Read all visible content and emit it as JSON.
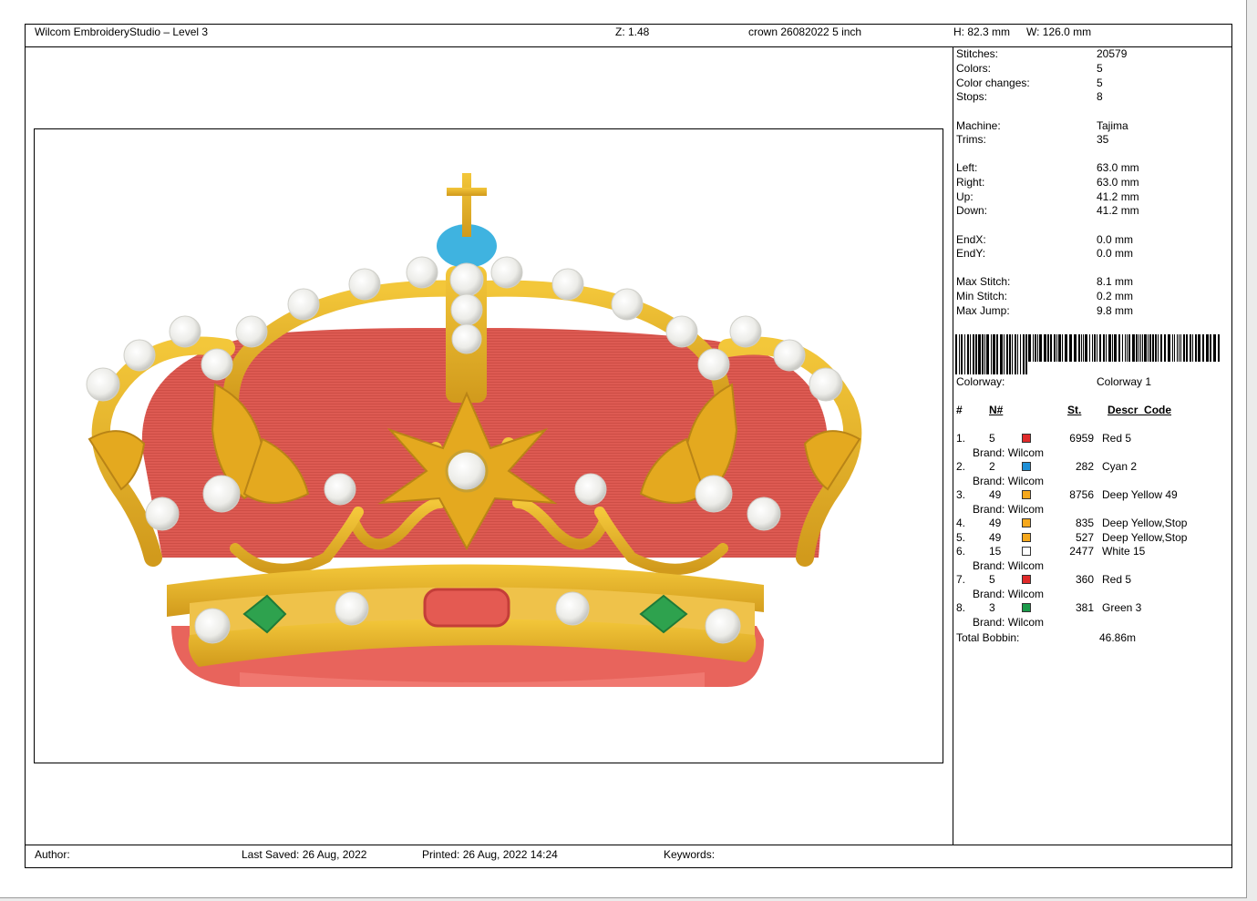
{
  "header": {
    "app_title": "Wilcom EmbroideryStudio – Level 3",
    "zoom": "Z: 1.48",
    "design_name": "crown 26082022 5 inch",
    "height": "H: 82.3 mm",
    "width": "W: 126.0 mm"
  },
  "stats": [
    {
      "label": "Stitches:",
      "value": "20579"
    },
    {
      "label": "Colors:",
      "value": "5"
    },
    {
      "label": "Color changes:",
      "value": "5"
    },
    {
      "label": "Stops:",
      "value": "8"
    },
    {
      "label": "Machine:",
      "value": "Tajima"
    },
    {
      "label": "Trims:",
      "value": "35"
    },
    {
      "label": "Left:",
      "value": "63.0 mm"
    },
    {
      "label": "Right:",
      "value": "63.0 mm"
    },
    {
      "label": "Up:",
      "value": "41.2 mm"
    },
    {
      "label": "Down:",
      "value": "41.2 mm"
    },
    {
      "label": "EndX:",
      "value": "0.0 mm"
    },
    {
      "label": "EndY:",
      "value": "0.0 mm"
    },
    {
      "label": "Max Stitch:",
      "value": "8.1 mm"
    },
    {
      "label": "Min Stitch:",
      "value": "0.2 mm"
    },
    {
      "label": "Max Jump:",
      "value": "9.8 mm"
    }
  ],
  "colorway": {
    "label": "Colorway:",
    "value": "Colorway 1"
  },
  "table": {
    "headers": {
      "index": "#",
      "needle": "N#",
      "stitches": "St.",
      "descr": "Descr_Code"
    },
    "rows": [
      {
        "index": "1.",
        "needle": "5",
        "color": "#e02a2a",
        "stitches": "6959",
        "descr": "Red 5",
        "brand": "Brand: Wilcom"
      },
      {
        "index": "2.",
        "needle": "2",
        "color": "#1e8fd6",
        "stitches": "282",
        "descr": "Cyan 2",
        "brand": "Brand: Wilcom"
      },
      {
        "index": "3.",
        "needle": "49",
        "color": "#f5a81c",
        "stitches": "8756",
        "descr": "Deep Yellow 49",
        "brand": "Brand: Wilcom"
      },
      {
        "index": "4.",
        "needle": "49",
        "color": "#f5a81c",
        "stitches": "835",
        "descr": "Deep Yellow,Stop",
        "brand": ""
      },
      {
        "index": "5.",
        "needle": "49",
        "color": "#f5a81c",
        "stitches": "527",
        "descr": "Deep Yellow,Stop",
        "brand": ""
      },
      {
        "index": "6.",
        "needle": "15",
        "color": "#ffffff",
        "stitches": "2477",
        "descr": "White 15",
        "brand": "Brand: Wilcom"
      },
      {
        "index": "7.",
        "needle": "5",
        "color": "#e02a2a",
        "stitches": "360",
        "descr": "Red 5",
        "brand": "Brand: Wilcom"
      },
      {
        "index": "8.",
        "needle": "3",
        "color": "#1b9a4a",
        "stitches": "381",
        "descr": "Green 3",
        "brand": "Brand: Wilcom"
      }
    ],
    "total_bobbin_label": "Total Bobbin:",
    "total_bobbin_value": "46.86m"
  },
  "footer": {
    "author": "Author:",
    "last_saved": "Last Saved: 26 Aug, 2022",
    "printed": "Printed: 26 Aug, 2022 14:24",
    "keywords": "Keywords:"
  },
  "colors": {
    "velvet": "#dd5a52",
    "gold": "#e9b324",
    "gold_dark": "#b98416",
    "pearl": "#f1f1ee",
    "cyan": "#3fb3e0",
    "green": "#2ea24e"
  }
}
